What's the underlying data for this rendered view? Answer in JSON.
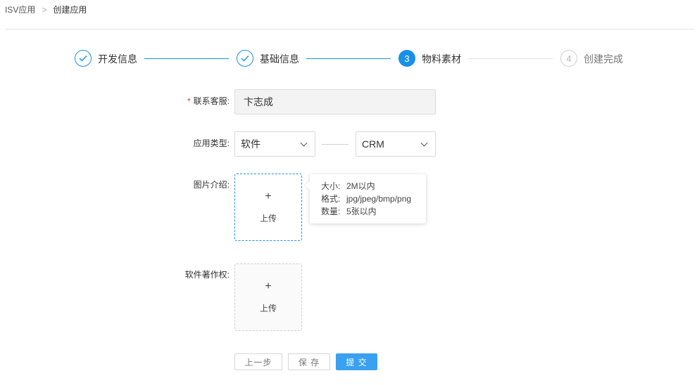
{
  "breadcrumb": {
    "root": "ISV应用",
    "separator": ">",
    "current": "创建应用"
  },
  "steps": [
    {
      "label": "开发信息",
      "status": "done",
      "icon": "check-icon"
    },
    {
      "label": "基础信息",
      "status": "done",
      "icon": "check-icon"
    },
    {
      "label": "物料素材",
      "status": "active",
      "number": "3"
    },
    {
      "label": "创建完成",
      "status": "todo",
      "number": "4"
    }
  ],
  "form": {
    "contact": {
      "label": "联系客服:",
      "required_mark": "*",
      "value": "卞志成"
    },
    "app_type": {
      "label": "应用类型:",
      "primary_value": "软件",
      "secondary_value": "CRM"
    },
    "images": {
      "label": "图片介绍:",
      "upload_plus": "+",
      "upload_label": "上传"
    },
    "copyright": {
      "label": "软件著作权:",
      "upload_plus": "+",
      "upload_label": "上传"
    }
  },
  "tooltip": {
    "lines": [
      {
        "key": "大小:",
        "value": "2M以内"
      },
      {
        "key": "格式:",
        "value": "jpg/jpeg/bmp/png"
      },
      {
        "key": "数量:",
        "value": "5张以内"
      }
    ]
  },
  "actions": {
    "prev": "上一步",
    "save": "保 存",
    "submit": "提 交"
  },
  "colors": {
    "accent": "#1890e6",
    "required": "#e03b3b"
  }
}
